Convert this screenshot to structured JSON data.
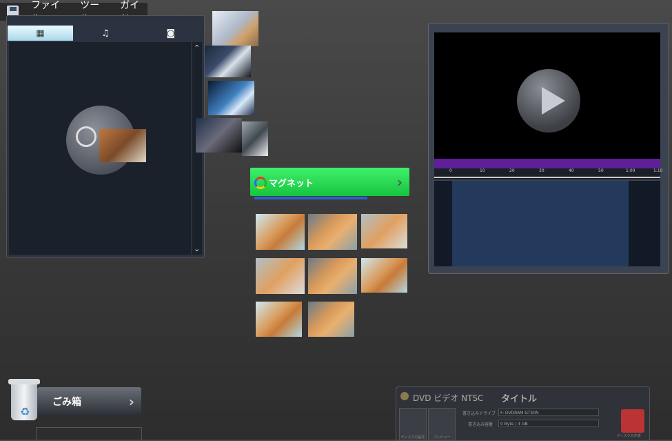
{
  "menubar": {
    "items": [
      "ファイル",
      "ツール",
      "ガイド"
    ]
  },
  "media_tabs": [
    {
      "icon": "film-icon",
      "glyph": "▦",
      "active": true
    },
    {
      "icon": "music-icon",
      "glyph": "♫",
      "active": false
    },
    {
      "icon": "camera-icon",
      "glyph": "◙",
      "active": false
    }
  ],
  "scroll": {
    "up": "⌃",
    "down": "⌄"
  },
  "magnet_button": {
    "label": "マグネット",
    "arrow": "›"
  },
  "trash": {
    "label": "ごみ箱",
    "arrow": "›"
  },
  "burn_panel": {
    "format": "DVD ビデオ NTSC",
    "title": "タイトル",
    "drive_label": "書き込みドライブ",
    "drive_value": "F: DVDRAM GT40N",
    "capacity_label": "書き込み容量",
    "capacity_value": "0 Byte / 4 GB",
    "btn1_caption": "ディスクの設定",
    "btn2_caption": "プレビュー",
    "create_caption": "ディスクの作成"
  },
  "ruler_ticks": [
    "0",
    "10",
    "20",
    "30",
    "40",
    "50",
    "1:00",
    "1:10"
  ]
}
